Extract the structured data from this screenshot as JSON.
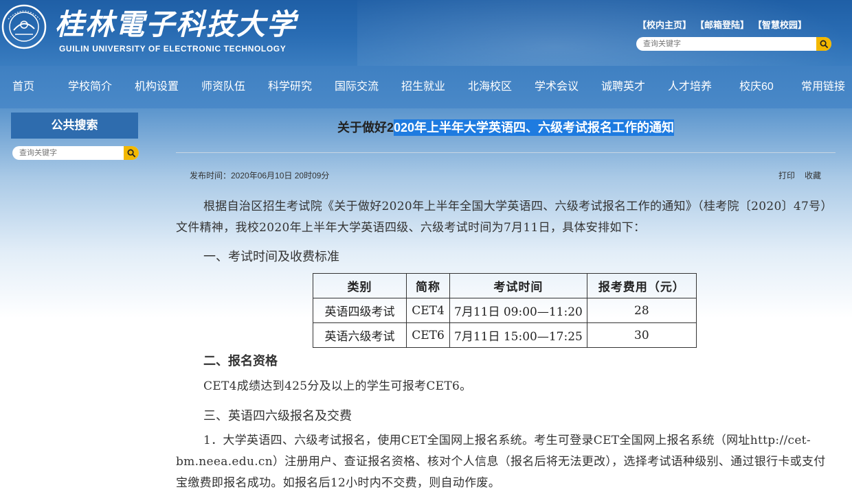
{
  "header": {
    "logo_cn": "桂林電子科技大学",
    "logo_en": "GUILIN UNIVERSITY OF ELECTRONIC TECHNOLOGY",
    "top_links": [
      "【校内主页】",
      "【邮箱登陆】",
      "【智慧校园】"
    ],
    "search_placeholder": "查询关键字"
  },
  "nav": {
    "items": [
      "首页",
      "学校简介",
      "机构设置",
      "师资队伍",
      "科学研究",
      "国际交流",
      "招生就业",
      "北海校区",
      "学术会议",
      "诚聘英才",
      "人才培养",
      "校庆60",
      "常用链接"
    ]
  },
  "sidebar": {
    "title": "公共搜索",
    "search_placeholder": "查询关键字"
  },
  "article": {
    "title_prefix": "关于做好2",
    "title_highlight": "020年上半年大学英语四、六级考试报名工作的通知",
    "pubtime": "发布时间：2020年06月10日 20时09分",
    "tools": [
      "打印",
      "收藏"
    ],
    "intro": "根据自治区招生考试院《关于做好2020年上半年全国大学英语四、六级考试报名工作的通知》（桂考院〔2020〕47号）文件精神，我校2020年上半年大学英语四级、六级考试时间为7月11日，具体安排如下：",
    "section1": "一、考试时间及收费标准",
    "table": {
      "headers": [
        "类别",
        "简称",
        "考试时间",
        "报考费用（元）"
      ],
      "rows": [
        [
          "英语四级考试",
          "CET4",
          "7月11日 09:00—11:20",
          "28"
        ],
        [
          "英语六级考试",
          "CET6",
          "7月11日 15:00—17:25",
          "30"
        ]
      ]
    },
    "section2": "二、报名资格",
    "eligibility": "CET4成绩达到425分及以上的学生可报考CET6。",
    "section3": "三、英语四六级报名及交费",
    "step1": "1．大学英语四、六级考试报名，使用CET全国网上报名系统。考生可登录CET全国网上报名系统（网址http://cet-bm.neea.edu.cn）注册用户、查证报名资格、核对个人信息（报名后将无法更改），选择考试语种级别、通过银行卡或支付宝缴费即报名成功。如报名后12小时内不交费，则自动作废。"
  },
  "colors": {
    "header_blue": "#1f5fa6",
    "nav_blue": "#4a89c8",
    "accent_yellow": "#f3b800",
    "highlight": "#1e7be0"
  }
}
